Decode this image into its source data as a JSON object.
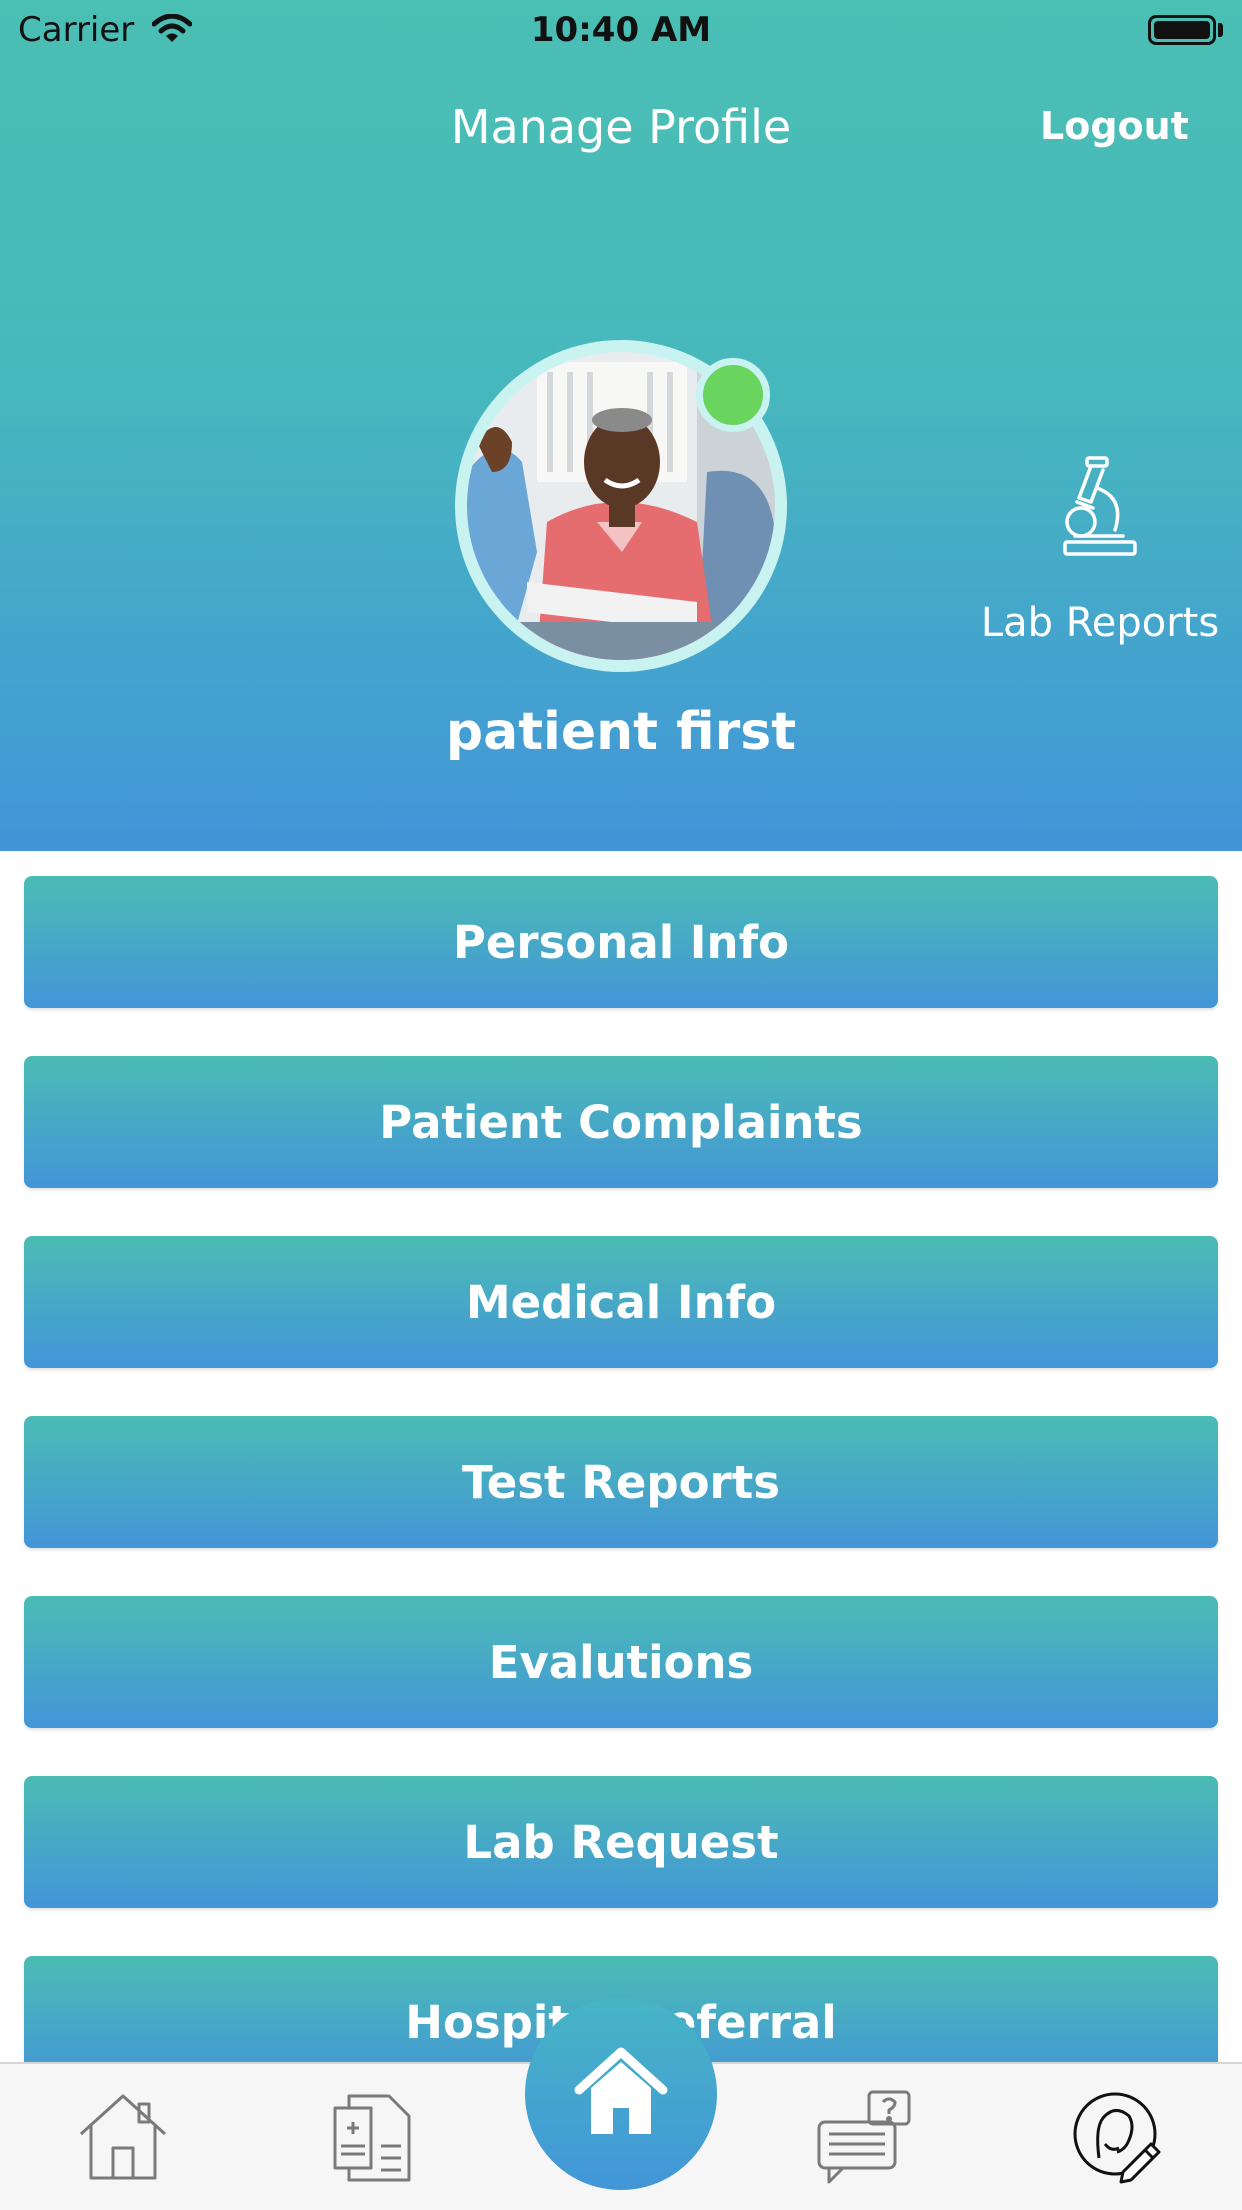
{
  "status_bar": {
    "carrier": "Carrier",
    "time": "10:40 AM"
  },
  "nav": {
    "title": "Manage Profile",
    "logout_label": "Logout"
  },
  "profile": {
    "name": "patient first",
    "online_status_color": "#69d45e"
  },
  "lab_reports": {
    "label": "Lab Reports",
    "icon": "microscope-icon"
  },
  "menu": {
    "items": [
      "Personal Info",
      "Patient Complaints",
      "Medical Info",
      "Test Reports",
      "Evalutions",
      "Lab Request",
      "Hospital Referral"
    ]
  },
  "tabbar": {
    "items": [
      "home-outline-icon",
      "medical-records-icon",
      "home-fab-icon",
      "help-chat-icon",
      "profile-edit-icon"
    ]
  },
  "colors": {
    "header_top": "#4abfb3",
    "header_bottom": "#4295d9",
    "button_top": "#4bbcb4",
    "button_bottom": "#4395d8"
  }
}
